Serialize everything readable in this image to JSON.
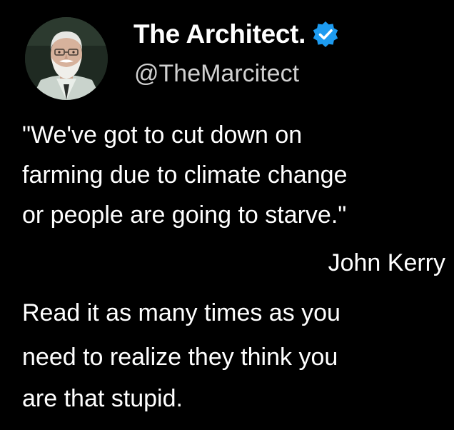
{
  "author": {
    "display_name": "The Architect.",
    "handle": "@TheMarcitect",
    "verified": true,
    "avatar_icon": "bearded-man-portrait",
    "verified_icon": "verified-badge-icon"
  },
  "tweet": {
    "quote_lines": [
      "\"We've got to cut down on",
      "farming due to climate change",
      "or people are going to starve.\""
    ],
    "attribution": "John Kerry",
    "comment_lines": [
      "Read it as many times as you",
      "need to realize they think you",
      "are that stupid."
    ]
  },
  "colors": {
    "background": "#000000",
    "text": "#ffffff",
    "handle_text": "#d0d0d0",
    "verified_badge": "#1d9bf0"
  }
}
